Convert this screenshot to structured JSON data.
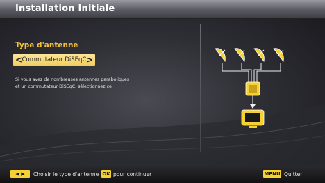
{
  "header": {
    "title": "Installation Initiale"
  },
  "antenna": {
    "label": "Type d'antenne",
    "selected_value": "Commutateur DiSEqC",
    "left_arrow": "<",
    "right_arrow": ">"
  },
  "description": {
    "line1": "Si vous avez de nombreuses antennes paraboliques",
    "line2": "et un commutateur DiSEqC, sélectionnez ce"
  },
  "footer": {
    "left_key_label": "◀ ▶",
    "left_text": "Choisir le type d'antenne",
    "ok_key_label": "OK",
    "ok_text": "pour continuer",
    "menu_key_label": "MENU",
    "menu_text": "Quitter"
  },
  "colors": {
    "accent": "#f2c23c",
    "selector_bg": "#f8dc7c",
    "key_bg": "#f5d132"
  }
}
